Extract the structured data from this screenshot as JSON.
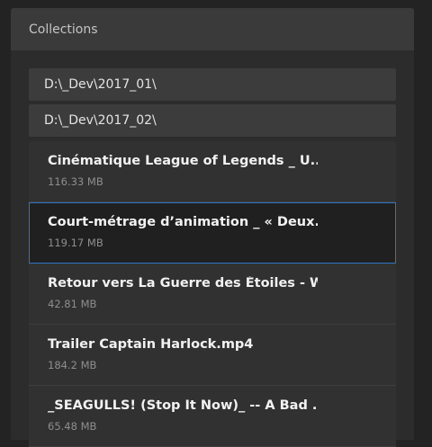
{
  "collections": {
    "title": "Collections",
    "paths": [
      "D:\\_Dev\\2017_01\\",
      "D:\\_Dev\\2017_02\\"
    ],
    "files": [
      {
        "name": "Cinématique League of Legends _ U...",
        "size": "116.33 MB",
        "selected": false
      },
      {
        "name": "Court-métrage d’animation _ « Deux...",
        "size": "119.17 MB",
        "selected": true
      },
      {
        "name": "Retour vers La Guerre des Étoiles - W...",
        "size": "42.81 MB",
        "selected": false
      },
      {
        "name": "Trailer Captain Harlock.mp4",
        "size": "184.2 MB",
        "selected": false
      },
      {
        "name": "_SEAGULLS! (Stop It Now)_ -- A Bad ...",
        "size": "65.48 MB",
        "selected": false
      }
    ]
  },
  "colors": {
    "accent": "#2f74c8",
    "background": "#232323",
    "panel": "#2c2c2c"
  }
}
